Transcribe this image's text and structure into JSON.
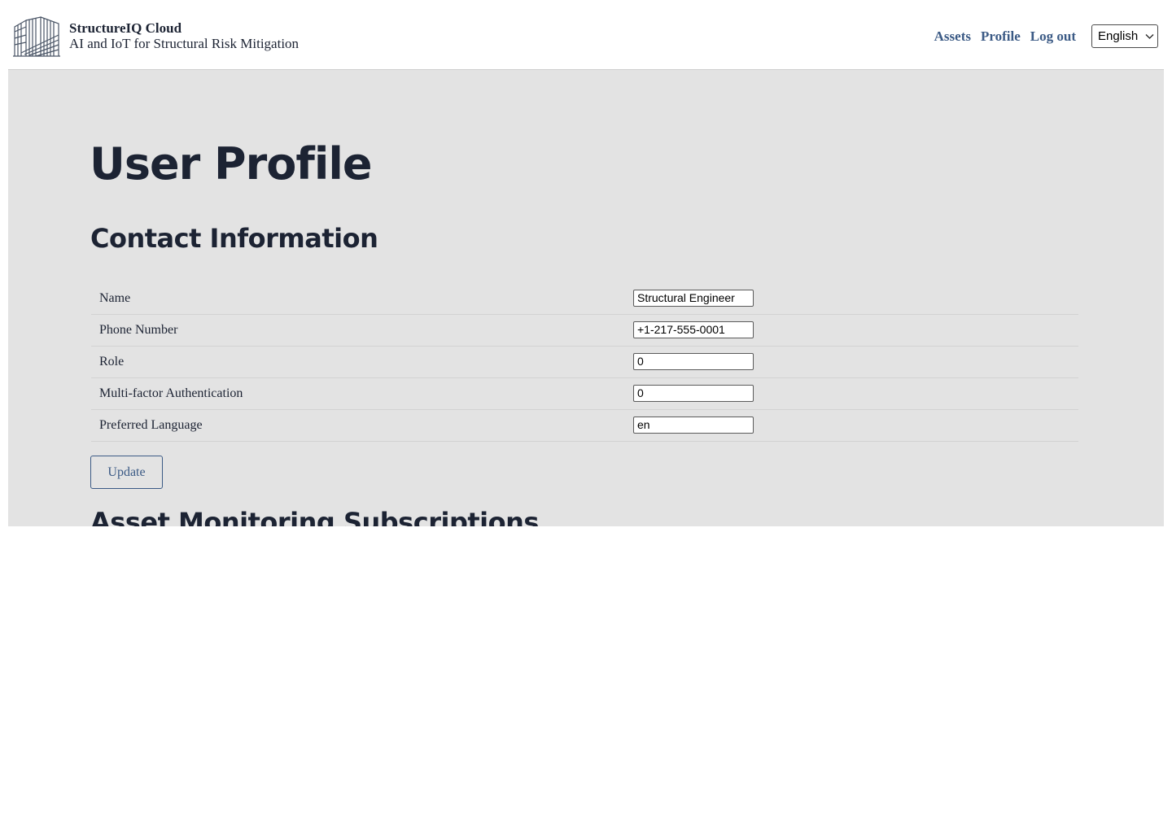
{
  "header": {
    "brand_title": "StructureIQ Cloud",
    "brand_subtitle": "AI and IoT for Structural Risk Mitigation",
    "nav": {
      "assets": "Assets",
      "profile": "Profile",
      "logout": "Log out"
    },
    "language_select": {
      "selected": "English"
    }
  },
  "main": {
    "page_title": "User Profile",
    "contact_section_title": "Contact Information",
    "fields": [
      {
        "label": "Name",
        "value": "Structural Engineer"
      },
      {
        "label": "Phone Number",
        "value": "+1-217-555-0001"
      },
      {
        "label": "Role",
        "value": "0"
      },
      {
        "label": "Multi-factor Authentication",
        "value": "0"
      },
      {
        "label": "Preferred Language",
        "value": "en"
      }
    ],
    "update_label": "Update",
    "subscriptions_section_title": "Asset Monitoring Subscriptions"
  },
  "colors": {
    "link": "#3b5a85",
    "text": "#1c2333",
    "panel_bg": "#e3e3e3"
  }
}
